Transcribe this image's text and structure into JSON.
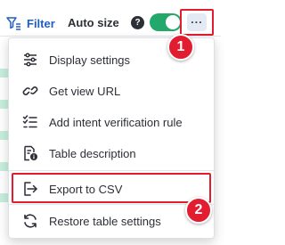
{
  "toolbar": {
    "filter_label": "Filter",
    "autosize_label": "Auto size",
    "help_glyph": "?",
    "autosize_enabled": true,
    "more_glyph": "···",
    "filter_icon": "filter-icon",
    "more_icon": "more-horizontal-icon"
  },
  "menu": {
    "items": [
      {
        "label": "Display settings",
        "icon": "sliders-icon"
      },
      {
        "label": "Get view URL",
        "icon": "link-icon"
      },
      {
        "label": "Add intent verification rule",
        "icon": "checklist-icon"
      },
      {
        "label": "Table description",
        "icon": "document-info-icon"
      },
      {
        "label": "Export to CSV",
        "icon": "export-icon"
      },
      {
        "label": "Restore table settings",
        "icon": "refresh-icon"
      }
    ]
  },
  "callouts": [
    "1",
    "2"
  ],
  "colors": {
    "accent_blue": "#1f5fbf",
    "toggle_green": "#23a86b",
    "callout_red": "#e21d2f",
    "text_dark": "#2c2f36"
  }
}
